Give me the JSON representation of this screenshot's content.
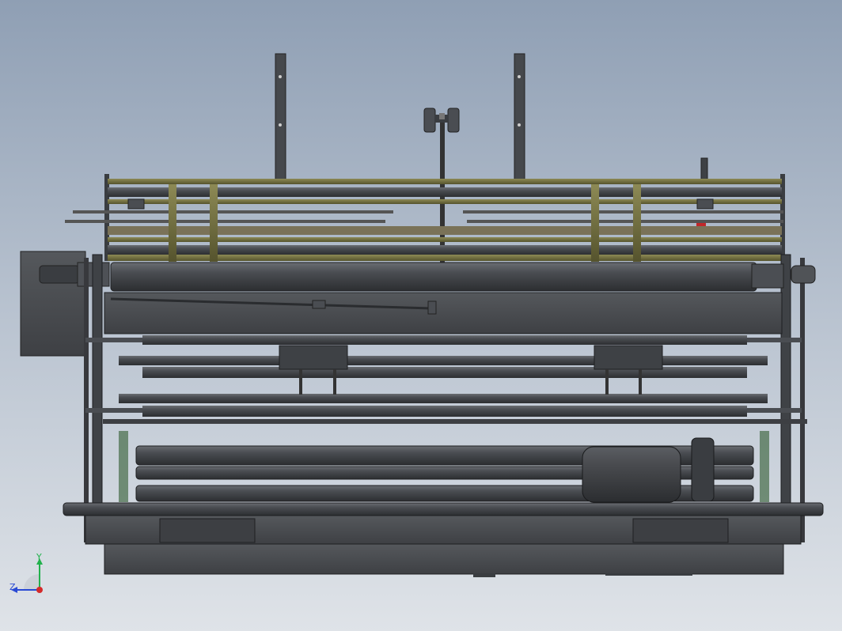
{
  "view": {
    "background_top": "#8f9fb4",
    "background_bottom": "#dfe3e8",
    "model_color": "#46494d",
    "rail_color": "#7d7a42",
    "accent_red": "#c0282a"
  },
  "triad": {
    "y_label": "Y",
    "z_label": "Z",
    "x_color": "#d42a2a",
    "y_color": "#22b14c",
    "z_color": "#2a4ad4"
  }
}
